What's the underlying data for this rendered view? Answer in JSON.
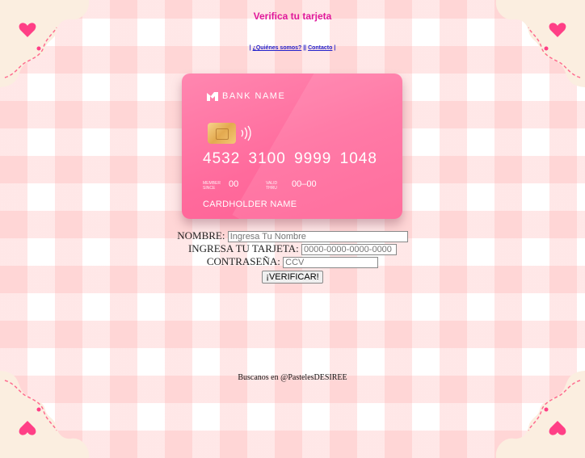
{
  "page": {
    "title": "Verifica tu tarjeta"
  },
  "nav": {
    "prefix": "| ",
    "link1": "¿Quiénes somos?",
    "sep": " || ",
    "link2": "Contacto",
    "suffix": " |"
  },
  "card": {
    "bank_name": "BANK NAME",
    "number": "4532  3100  9999  1048",
    "member_since_label": "MEMBER SINCE",
    "member_since_value": "00",
    "valid_thru_label": "VALID THRU",
    "valid_thru_value": "00–00",
    "holder": "CARDHOLDER NAME",
    "color": "#ff6a9c"
  },
  "form": {
    "name_label": "NOMBRE:",
    "name_placeholder": "Ingresa Tu Nombre",
    "card_label": "INGRESA TU TARJETA:",
    "card_placeholder": "0000-0000-0000-0000",
    "password_label": "CONTRASEÑA:",
    "password_placeholder": "CCV",
    "submit_label": "¡VERIFICAR!"
  },
  "footer": {
    "text": "Buscanos en @PastelesDESIREE"
  },
  "colors": {
    "title": "#e0199b",
    "link": "#2222cc",
    "stripe": "#ffd1d1",
    "heart": "#ff3f86"
  },
  "icons": {
    "corner": "heart-corner-icon",
    "nfc": "contactless-icon",
    "chip": "chip-icon",
    "logo": "bank-logo-icon"
  }
}
